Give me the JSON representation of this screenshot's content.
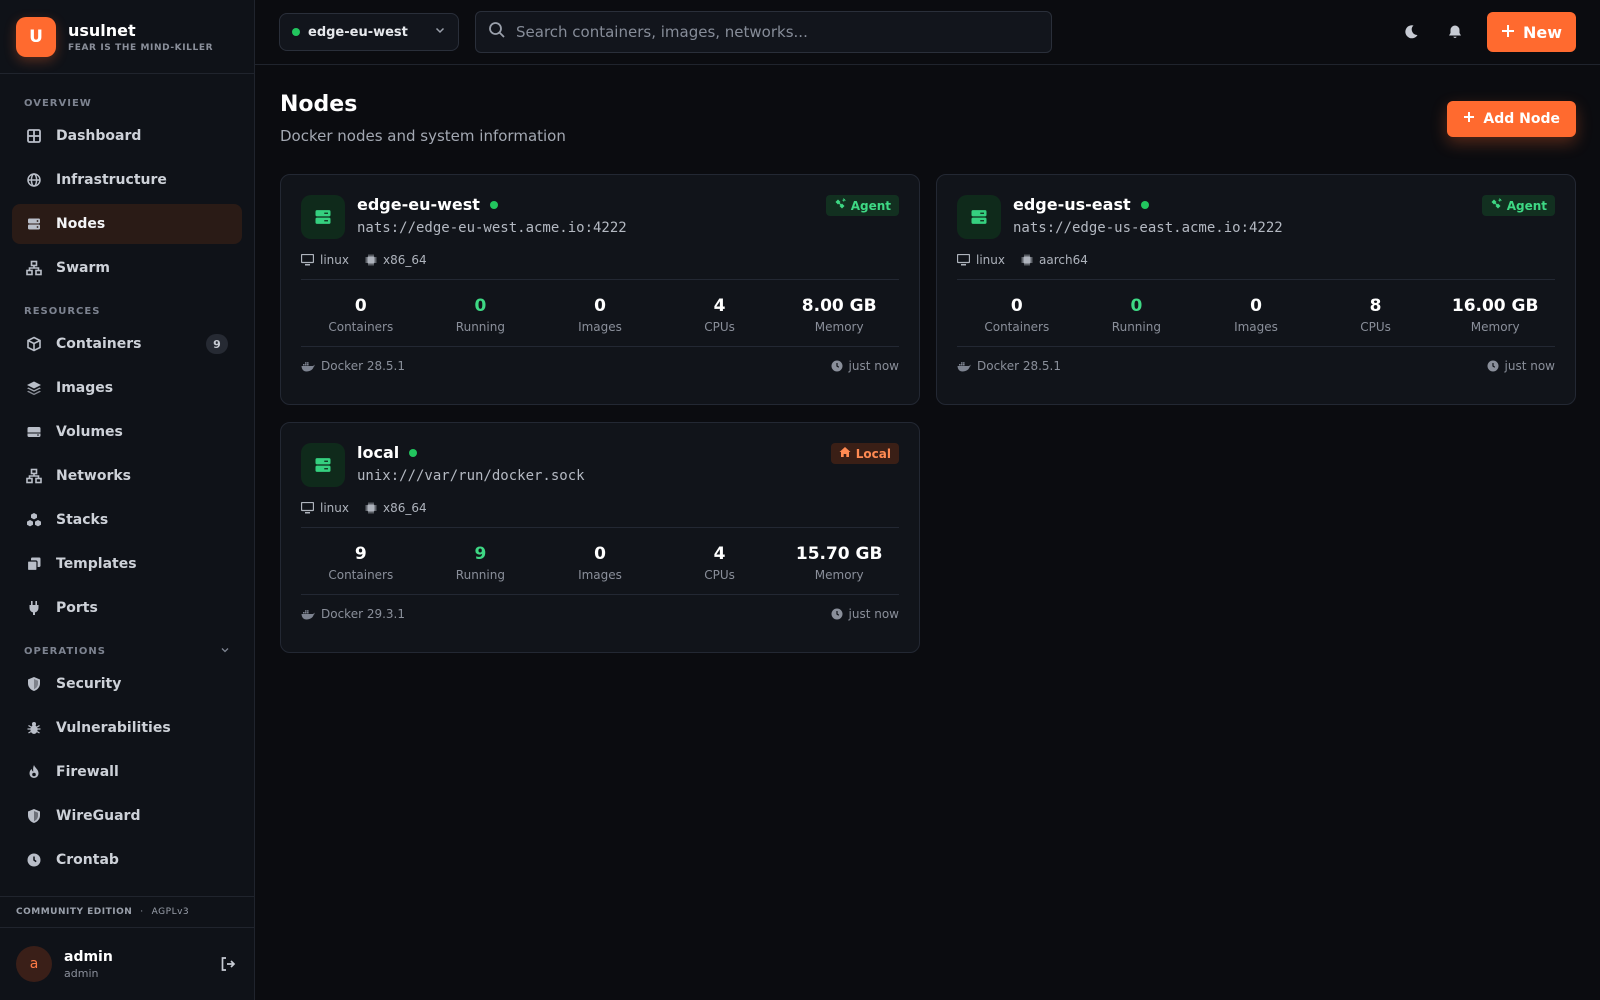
{
  "brand": {
    "logo_letter": "U",
    "name": "usulnet",
    "tagline": "FEAR IS THE MIND-KILLER"
  },
  "sidebar": {
    "sections": [
      {
        "title": "OVERVIEW",
        "items": [
          {
            "label": "Dashboard",
            "icon": "grid-icon"
          },
          {
            "label": "Infrastructure",
            "icon": "globe-icon"
          },
          {
            "label": "Nodes",
            "icon": "server-icon",
            "active": true
          },
          {
            "label": "Swarm",
            "icon": "sitemap-icon"
          }
        ]
      },
      {
        "title": "RESOURCES",
        "items": [
          {
            "label": "Containers",
            "icon": "cube-icon",
            "badge": "9"
          },
          {
            "label": "Images",
            "icon": "layers-icon"
          },
          {
            "label": "Volumes",
            "icon": "hdd-icon"
          },
          {
            "label": "Networks",
            "icon": "network-icon"
          },
          {
            "label": "Stacks",
            "icon": "cubes-icon"
          },
          {
            "label": "Templates",
            "icon": "copy-icon"
          },
          {
            "label": "Ports",
            "icon": "plug-icon"
          }
        ]
      },
      {
        "title": "OPERATIONS",
        "items": [
          {
            "label": "Security",
            "icon": "shield-icon"
          },
          {
            "label": "Vulnerabilities",
            "icon": "bug-icon"
          },
          {
            "label": "Firewall",
            "icon": "fire-icon"
          },
          {
            "label": "WireGuard",
            "icon": "shield-half-icon"
          },
          {
            "label": "Crontab",
            "icon": "clock-icon"
          }
        ]
      }
    ],
    "edition": {
      "name": "COMMUNITY EDITION",
      "license": "AGPLv3"
    },
    "user": {
      "initial": "a",
      "name": "admin",
      "role": "admin"
    }
  },
  "topbar": {
    "node_selector": "edge-eu-west",
    "search_placeholder": "Search containers, images, networks...",
    "new_label": "New"
  },
  "page": {
    "title": "Nodes",
    "subtitle": "Docker nodes and system information",
    "add_label": "Add Node"
  },
  "stat_labels": {
    "containers": "Containers",
    "running": "Running",
    "images": "Images",
    "cpus": "CPUs",
    "memory": "Memory"
  },
  "nodes": [
    {
      "name": "edge-eu-west",
      "url": "nats://edge-eu-west.acme.io:4222",
      "tag": "Agent",
      "os": "linux",
      "arch": "x86_64",
      "containers": "0",
      "running": "0",
      "images": "0",
      "cpus": "4",
      "memory": "8.00 GB",
      "docker": "Docker 28.5.1",
      "updated": "just now"
    },
    {
      "name": "edge-us-east",
      "url": "nats://edge-us-east.acme.io:4222",
      "tag": "Agent",
      "os": "linux",
      "arch": "aarch64",
      "containers": "0",
      "running": "0",
      "images": "0",
      "cpus": "8",
      "memory": "16.00 GB",
      "docker": "Docker 28.5.1",
      "updated": "just now"
    },
    {
      "name": "local",
      "url": "unix:///var/run/docker.sock",
      "tag": "Local",
      "os": "linux",
      "arch": "x86_64",
      "containers": "9",
      "running": "9",
      "images": "0",
      "cpus": "4",
      "memory": "15.70 GB",
      "docker": "Docker 29.3.1",
      "updated": "just now"
    }
  ],
  "colors": {
    "accent": "#ff6a2f",
    "online": "#22c55e",
    "agent": "#3ed884",
    "local": "#ff8a52"
  }
}
